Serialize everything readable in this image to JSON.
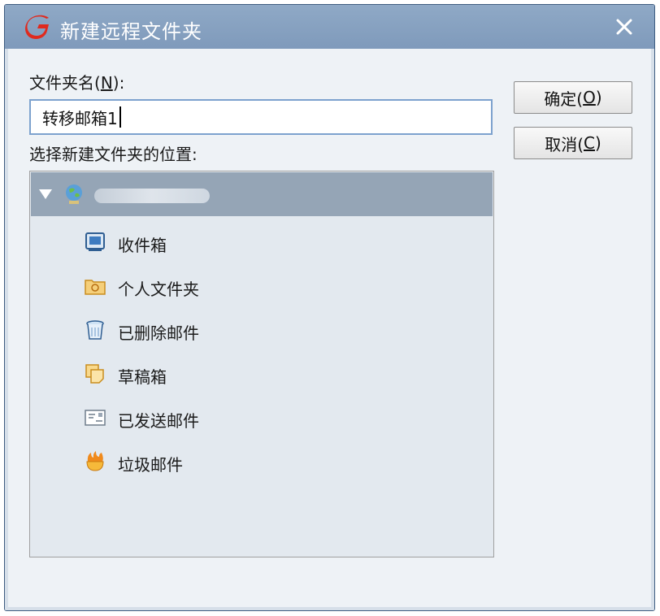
{
  "window": {
    "title": "新建远程文件夹"
  },
  "form": {
    "name_label_prefix": "文件夹名(",
    "name_label_key": "N",
    "name_label_suffix": "):",
    "name_value": "转移邮箱1",
    "location_label": "选择新建文件夹的位置:"
  },
  "buttons": {
    "ok_prefix": "确定(",
    "ok_key": "O",
    "ok_suffix": ")",
    "cancel_prefix": "取消(",
    "cancel_key": "C",
    "cancel_suffix": ")"
  },
  "tree": {
    "items": [
      {
        "label": "收件箱",
        "icon": "inbox-icon"
      },
      {
        "label": "个人文件夹",
        "icon": "folder-icon"
      },
      {
        "label": "已删除邮件",
        "icon": "trash-icon"
      },
      {
        "label": "草稿箱",
        "icon": "drafts-icon"
      },
      {
        "label": "已发送邮件",
        "icon": "sent-icon"
      },
      {
        "label": "垃圾邮件",
        "icon": "junk-icon"
      }
    ]
  },
  "colors": {
    "titlebar": "#8fa9c6",
    "selection": "#95a5b6",
    "tree_bg": "#e3e9ef",
    "input_border": "#7da2ce"
  }
}
